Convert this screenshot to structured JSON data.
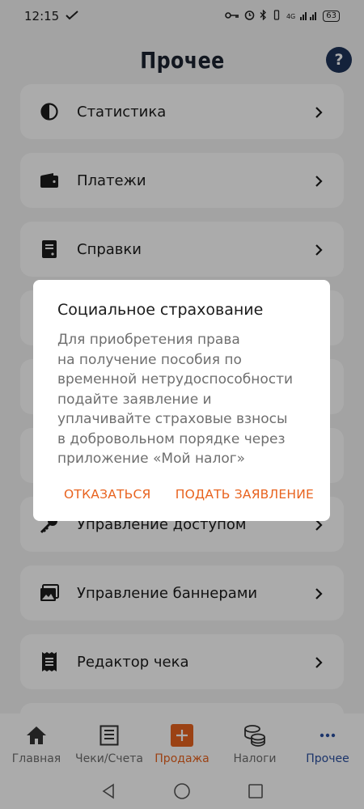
{
  "status_bar": {
    "time": "12:15",
    "network": "4G",
    "battery": "63"
  },
  "header": {
    "title": "Прочее",
    "help_label": "?"
  },
  "menu": {
    "items": [
      {
        "label": "Статистика",
        "icon": "pie-chart-icon"
      },
      {
        "label": "Платежи",
        "icon": "wallet-icon"
      },
      {
        "label": "Справки",
        "icon": "document-icon"
      },
      {
        "label": "Управление доступом",
        "icon": "key-icon"
      },
      {
        "label": "Управление баннерами",
        "icon": "image-icon"
      },
      {
        "label": "Редактор чека",
        "icon": "receipt-icon"
      }
    ]
  },
  "dialog": {
    "title": "Социальное страхование",
    "body": "Для приобретения права\nна получение пособия по\nвременной нетрудоспособности\nподайте заявление и\nуплачивайте страховые взносы\nв добровольном порядке через\nприложение «Мой налог»",
    "decline": "ОТКАЗАТЬСЯ",
    "apply": "ПОДАТЬ ЗАЯВЛЕНИЕ"
  },
  "bottom_nav": {
    "items": [
      {
        "label": "Главная",
        "icon": "home-icon"
      },
      {
        "label": "Чеки/Счета",
        "icon": "receipts-icon"
      },
      {
        "label": "Продажа",
        "icon": "plus-icon"
      },
      {
        "label": "Налоги",
        "icon": "coins-icon"
      },
      {
        "label": "Прочее",
        "icon": "more-icon"
      }
    ]
  },
  "colors": {
    "accent": "#e8631f",
    "active": "#2b4fa0",
    "help": "#1e3358"
  }
}
